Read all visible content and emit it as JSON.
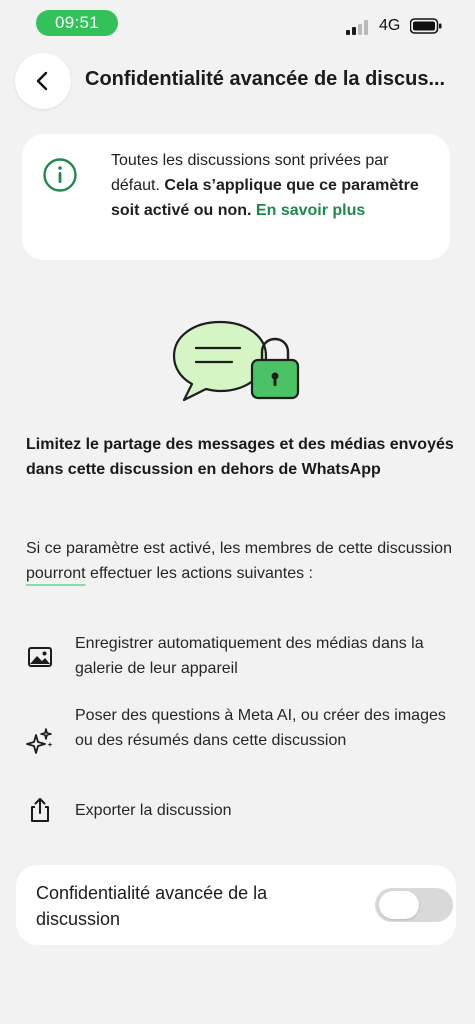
{
  "status_bar": {
    "time": "09:51",
    "network": "4G"
  },
  "header": {
    "title": "Confidentialité avancée de la discus..."
  },
  "info_card": {
    "text_plain": "Toutes les discussions sont privées par défaut.",
    "text_bold": "Cela s’applique que ce paramètre soit activé ou non.",
    "link": "En savoir plus"
  },
  "heading": "Limitez le partage des messages et des médias envoyés dans cette discussion en dehors de WhatsApp",
  "description": {
    "before": "Si ce paramètre est activé, les membres de cette discussion ",
    "underlined": "pourront",
    "after": " effectuer les actions suivantes :"
  },
  "items": [
    {
      "icon": "image-icon",
      "label": "Enregistrer automatiquement des médias dans la galerie de leur appareil"
    },
    {
      "icon": "sparkle-icon",
      "label": "Poser des questions à Meta AI, ou créer des images ou des résumés dans cette discussion"
    },
    {
      "icon": "share-icon",
      "label": "Exporter la discussion"
    }
  ],
  "toggle": {
    "label": "Confidentialité avancée de la discussion",
    "state": "off"
  },
  "colors": {
    "accent": "#1f8a4c",
    "time_pill": "#33c15a",
    "bubble_fill": "#d6f5c4",
    "lock_fill": "#4cc266"
  }
}
